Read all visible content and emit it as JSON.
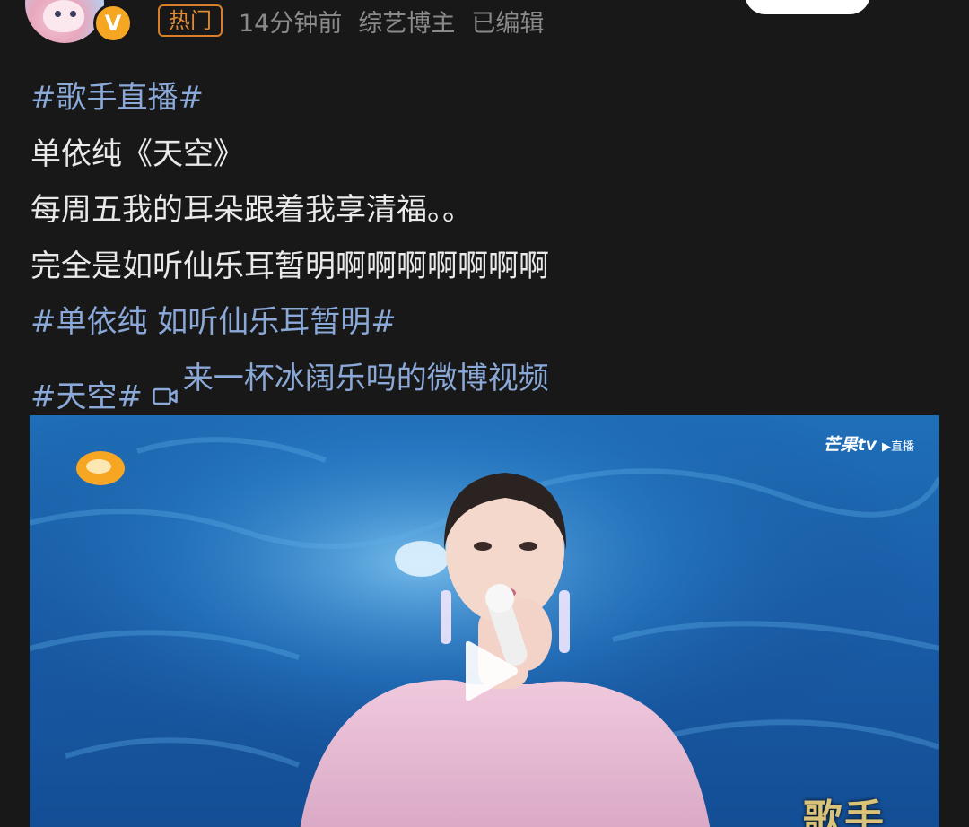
{
  "header": {
    "hot_tag": "热门",
    "time": "14分钟前",
    "role": "综艺博主",
    "edited": "已编辑",
    "verified_mark": "V"
  },
  "post": {
    "lines": [
      {
        "type": "topic",
        "text": "#歌手直播#"
      },
      {
        "type": "text",
        "text": "单依纯《天空》"
      },
      {
        "type": "text",
        "text": "每周五我的耳朵跟着我享清福。。"
      },
      {
        "type": "text",
        "text": "完全是如听仙乐耳暂明啊啊啊啊啊啊啊"
      },
      {
        "type": "topic",
        "text": "#单依纯 如听仙乐耳暂明#"
      }
    ],
    "last_line": {
      "topic": "#天空#",
      "video_link": "来一杯冰阔乐吗的微博视频",
      "video_link_icon": "video-camera-icon"
    }
  },
  "video": {
    "watermark_brand": "芒果tv",
    "watermark_live": "▶直播",
    "show_logo_text": "歌手",
    "station_logo_icon": "hunan-tv-logo-icon",
    "play_icon": "play-icon"
  },
  "colors": {
    "background": "#181818",
    "body_text": "#e9e9e9",
    "link": "#8aa8d8",
    "hot_tag": "#e08a34",
    "meta_text": "#8a8a8a",
    "verified": "#f5a623"
  }
}
